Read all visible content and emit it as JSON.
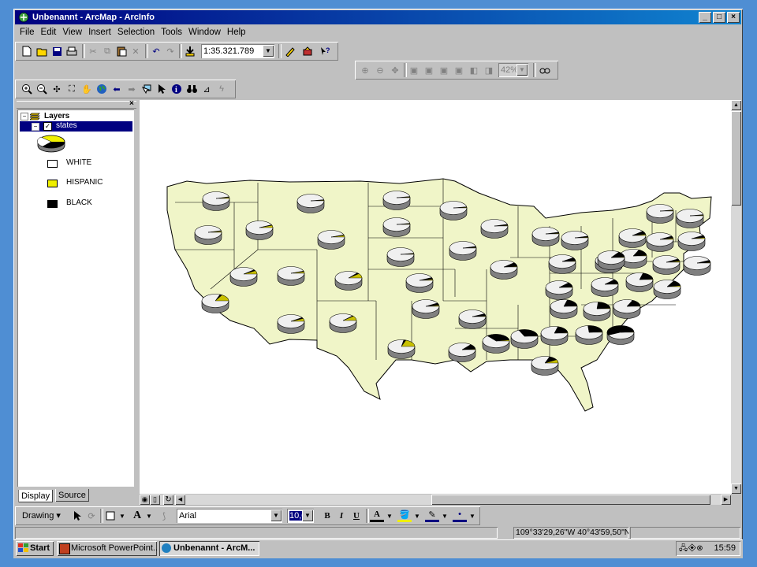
{
  "window": {
    "title": "Unbenannt - ArcMap - ArcInfo",
    "controls": [
      "_",
      "□",
      "×"
    ]
  },
  "menu": [
    "File",
    "Edit",
    "View",
    "Insert",
    "Selection",
    "Tools",
    "Window",
    "Help"
  ],
  "standard_toolbar": {
    "scale": "1:35.321.789"
  },
  "layout_toolbar": {
    "zoom_percent": "42%"
  },
  "toc": {
    "root_label": "Layers",
    "layer_name": "states",
    "legend": [
      {
        "label": "WHITE",
        "color": "#ffffff"
      },
      {
        "label": "HISPANIC",
        "color": "#f0f000"
      },
      {
        "label": "BLACK",
        "color": "#000000"
      }
    ],
    "tabs": [
      "Display",
      "Source"
    ]
  },
  "map": {
    "land_color": "#f0f5c8",
    "pie_colors": {
      "white": "#f0f0f0",
      "hispanic": "#c8c000",
      "black": "#000000",
      "side": "#808080"
    }
  },
  "drawing_toolbar": {
    "drawing_label": "Drawing",
    "font_name": "Arial",
    "font_size": "10,0",
    "bold": "B",
    "italic": "I",
    "underline": "U",
    "text_tool": "A"
  },
  "status": {
    "coordinates": "109°33'29,26\"W  40°43'59,50\"N"
  },
  "taskbar": {
    "start": "Start",
    "tasks": [
      "Microsoft PowerPoint...",
      "Unbenannt - ArcM..."
    ],
    "clock": "15:59"
  }
}
